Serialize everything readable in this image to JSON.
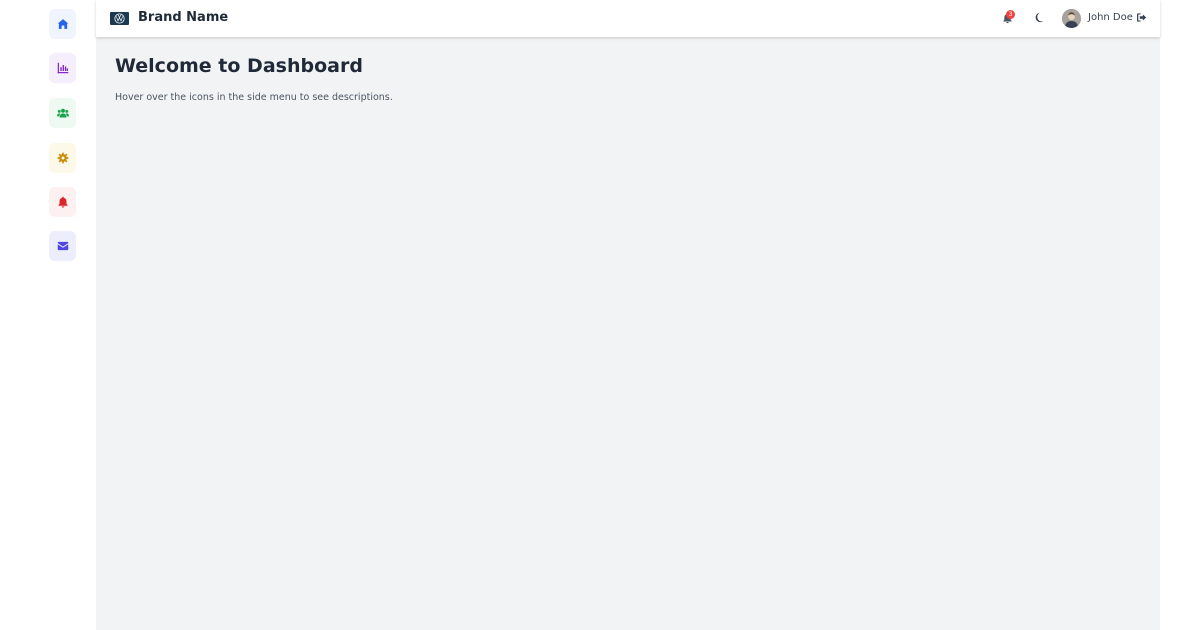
{
  "brand": {
    "name": "Brand Name",
    "logo": "vw-logo"
  },
  "sidebar": {
    "items": [
      {
        "icon": "home-icon",
        "color": "#2563eb",
        "bg": "#eff4ff"
      },
      {
        "icon": "chart-bar-icon",
        "color": "#7e22ce",
        "bg": "#f5effd"
      },
      {
        "icon": "users-icon",
        "color": "#16a34a",
        "bg": "#edf9f1"
      },
      {
        "icon": "gear-icon",
        "color": "#ca8a04",
        "bg": "#fdf9e8"
      },
      {
        "icon": "bell-icon",
        "color": "#dc2626",
        "bg": "#fdf0f0"
      },
      {
        "icon": "envelope-icon",
        "color": "#4f46e5",
        "bg": "#eceefc"
      }
    ]
  },
  "header": {
    "notification_count": "3",
    "user_name": "John Doe",
    "icons": {
      "notifications": "bell-icon",
      "theme": "moon-icon",
      "logout": "sign-out-icon"
    }
  },
  "main": {
    "title": "Welcome to Dashboard",
    "description": "Hover over the icons in the side menu to see descriptions."
  }
}
